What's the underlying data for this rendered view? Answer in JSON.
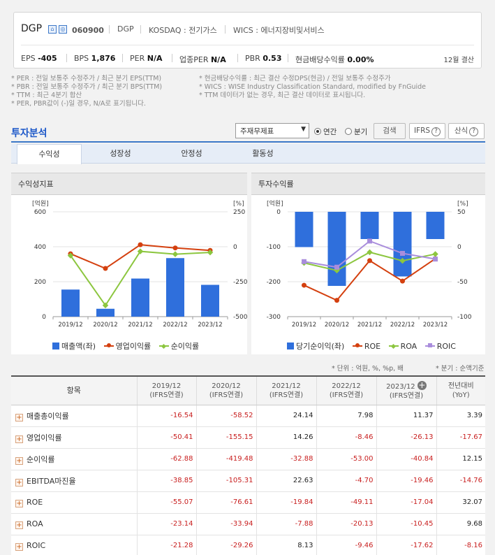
{
  "company": {
    "name": "DGP",
    "code": "060900",
    "meta": [
      "DGP",
      "KOSDAQ : 전기가스",
      "WICS : 에너지장비및서비스"
    ],
    "indicators": [
      {
        "label": "EPS",
        "value": "-405"
      },
      {
        "label": "BPS",
        "value": "1,876"
      },
      {
        "label": "PER",
        "value": "N/A"
      },
      {
        "label": "업종PER",
        "value": "N/A"
      },
      {
        "label": "PBR",
        "value": "0.53"
      },
      {
        "label": "현금배당수익률",
        "value": "0.00%"
      }
    ],
    "settlement": "12월 결산"
  },
  "notes": {
    "left": [
      "* PER : 전일 보통주 수정주가 / 최근 분기 EPS(TTM)",
      "* PBR : 전일 보통주 수정주가 / 최근 분기 BPS(TTM)",
      "* TTM : 최근 4분기 합산",
      "* PER, PBR값이 (-)일 경우, N/A로 표기됩니다."
    ],
    "right": [
      "* 현금배당수익률 : 최근 결산 수정DPS(현금) / 전일 보통주 수정주가",
      "* WICS : WISE Industry Classification Standard, modified by FnGuide",
      "* TTM 데이터가 없는 경우, 최근 결산 데이터로 표시됩니다."
    ]
  },
  "section": {
    "title": "투자분석",
    "select_value": "주재무제표",
    "radio_annual": "연간",
    "radio_quarter": "분기",
    "search_button": "검색",
    "ifrs_button": "IFRS",
    "formula_button": "산식"
  },
  "tabs": [
    "수익성",
    "성장성",
    "안정성",
    "활동성"
  ],
  "panels": {
    "left_title": "수익성지표",
    "right_title": "투자수익률"
  },
  "colors": {
    "bar": "#2f6fdc",
    "orange": "#d4400f",
    "green": "#8cc63f",
    "purple": "#a98ddc",
    "negative": "#c81e1e"
  },
  "chart_data": [
    {
      "type": "bar",
      "categories": [
        "2019/12",
        "2020/12",
        "2021/12",
        "2022/12",
        "2023/12"
      ],
      "left_axis": {
        "unit": "[억원]",
        "ylim": [
          0,
          600
        ],
        "ticks": [
          "600",
          "400",
          "200",
          "0"
        ]
      },
      "right_axis": {
        "unit": "[%]",
        "ylim": [
          -500,
          250
        ],
        "ticks": [
          "250",
          "0",
          "-250",
          "-500"
        ]
      },
      "series": [
        {
          "name": "매출액(좌)",
          "type": "bar",
          "axis": "left",
          "values": [
            155,
            45,
            218,
            335,
            182
          ]
        },
        {
          "name": "영업이익률",
          "type": "line",
          "axis": "right",
          "values": [
            -50.41,
            -155.15,
            14.26,
            -8.46,
            -26.13
          ]
        },
        {
          "name": "순이익률",
          "type": "line",
          "axis": "right",
          "values": [
            -62.88,
            -419.48,
            -32.88,
            -53.0,
            -40.84
          ]
        }
      ]
    },
    {
      "type": "bar",
      "categories": [
        "2019/12",
        "2020/12",
        "2021/12",
        "2022/12",
        "2023/12"
      ],
      "left_axis": {
        "unit": "[억원]",
        "ylim": [
          -300,
          0
        ],
        "ticks": [
          "0",
          "-100",
          "-200",
          "-300"
        ]
      },
      "right_axis": {
        "unit": "[%]",
        "ylim": [
          -100,
          50
        ],
        "ticks": [
          "50",
          "0",
          "-50",
          "-100"
        ]
      },
      "series": [
        {
          "name": "당기순이익(좌)",
          "type": "bar",
          "axis": "left",
          "values": [
            -101,
            -212,
            -78,
            -185,
            -78
          ]
        },
        {
          "name": "ROE",
          "type": "line",
          "axis": "right",
          "values": [
            -55.07,
            -76.61,
            -19.84,
            -49.11,
            -17.04
          ]
        },
        {
          "name": "ROA",
          "type": "line",
          "axis": "right",
          "values": [
            -23.14,
            -33.94,
            -7.88,
            -20.13,
            -10.45
          ]
        },
        {
          "name": "ROIC",
          "type": "line",
          "axis": "right",
          "values": [
            -21.28,
            -29.26,
            8.13,
            -9.46,
            -17.62
          ]
        }
      ]
    }
  ],
  "unit_note_left": "* 단위 : 억원, %, %p, 배",
  "unit_note_right": "* 분기 : 순액기준",
  "table": {
    "header_item": "항목",
    "columns": [
      {
        "year": "2019/12",
        "sub": "(IFRS연결)"
      },
      {
        "year": "2020/12",
        "sub": "(IFRS연결)"
      },
      {
        "year": "2021/12",
        "sub": "(IFRS연결)"
      },
      {
        "year": "2022/12",
        "sub": "(IFRS연결)"
      },
      {
        "year": "2023/12",
        "sub": "(IFRS연결)"
      },
      {
        "year": "전년대비",
        "sub": "(YoY)"
      }
    ],
    "rows": [
      {
        "label": "매출총이익률",
        "values": [
          "-16.54",
          "-58.52",
          "24.14",
          "7.98",
          "11.37",
          "3.39"
        ]
      },
      {
        "label": "영업이익률",
        "values": [
          "-50.41",
          "-155.15",
          "14.26",
          "-8.46",
          "-26.13",
          "-17.67"
        ]
      },
      {
        "label": "순이익률",
        "values": [
          "-62.88",
          "-419.48",
          "-32.88",
          "-53.00",
          "-40.84",
          "12.15"
        ]
      },
      {
        "label": "EBITDA마진율",
        "values": [
          "-38.85",
          "-105.31",
          "22.63",
          "-4.70",
          "-19.46",
          "-14.76"
        ]
      },
      {
        "label": "ROE",
        "values": [
          "-55.07",
          "-76.61",
          "-19.84",
          "-49.11",
          "-17.04",
          "32.07"
        ]
      },
      {
        "label": "ROA",
        "values": [
          "-23.14",
          "-33.94",
          "-7.88",
          "-20.13",
          "-10.45",
          "9.68"
        ]
      },
      {
        "label": "ROIC",
        "values": [
          "-21.28",
          "-29.26",
          "8.13",
          "-9.46",
          "-17.62",
          "-8.16"
        ]
      }
    ]
  }
}
